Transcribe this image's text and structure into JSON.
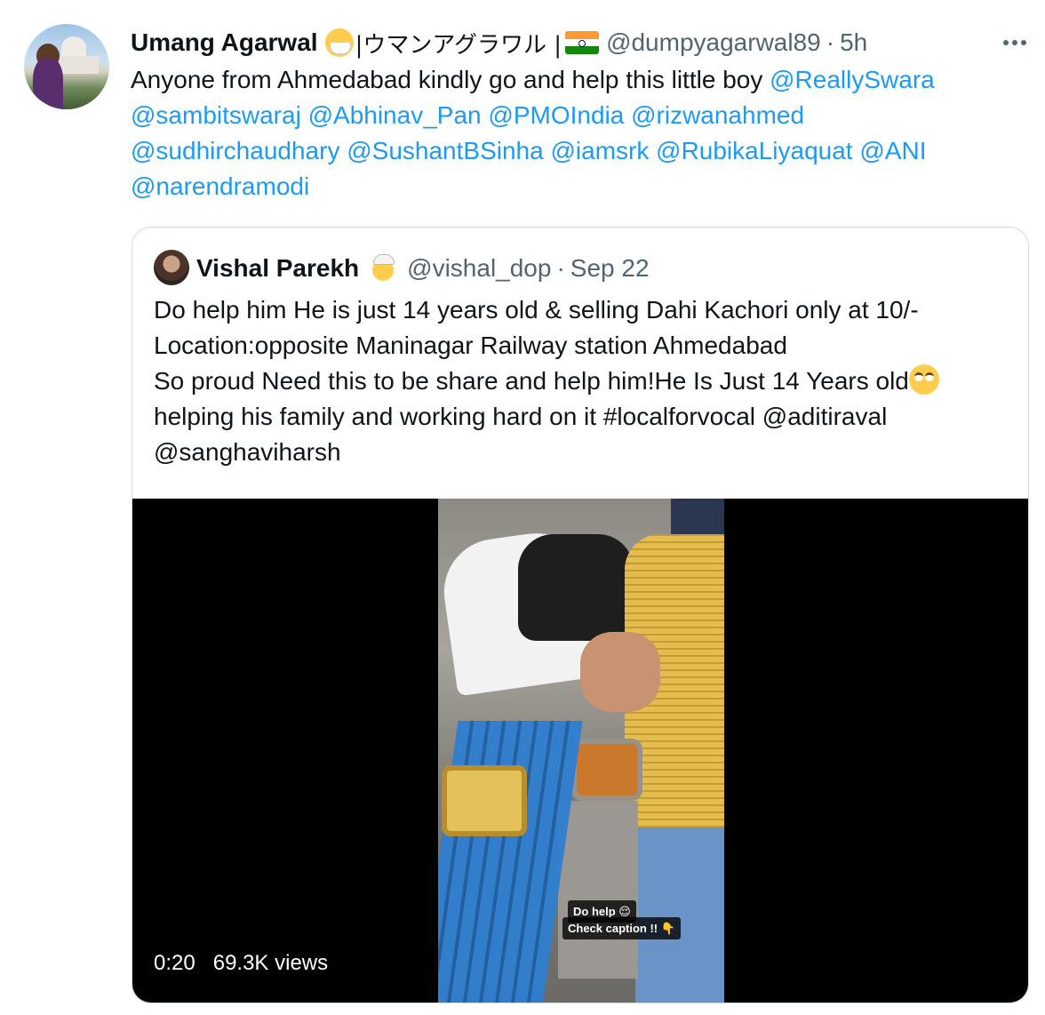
{
  "tweet": {
    "author_name": "Umang Agarwal",
    "author_suffix": "|ウマンアグラワル |",
    "author_handle": "@dumpyagarwal89",
    "dot": "·",
    "time": "5h",
    "text_plain": "Anyone from Ahmedabad kindly go and help this little boy ",
    "mentions": [
      "@ReallySwara",
      "@sambitswaraj",
      "@Abhinav_Pan",
      "@PMOIndia",
      "@rizwanahmed",
      "@sudhirchaudhary",
      "@SushantBSinha",
      "@iamsrk",
      "@RubikaLiyaquat",
      "@ANI",
      "@narendramodi"
    ],
    "icons": {
      "mask": "face-with-medical-mask-icon",
      "flag": "india-flag-icon",
      "more": "more-options-icon"
    }
  },
  "quote": {
    "author_name": "Vishal Parekh",
    "author_handle": "@vishal_dop",
    "dot": "·",
    "date": "Sep 22",
    "lines": [
      "Do help him He is just 14 years old & selling Dahi Kachori only at 10/-",
      "Location:opposite Maninagar Railway station Ahmedabad",
      "So proud Need this to be share and help him!He Is Just 14 Years old",
      "helping his family and working hard on it #localforvocal @aditiraval",
      "@sanghaviharsh"
    ],
    "icons": {
      "badge": "person-with-turban-icon",
      "eyeroll": "face-with-rolling-eyes-icon"
    },
    "video": {
      "duration": "0:20",
      "views": "69.3K views",
      "overlay_line1": "Do help 😌",
      "overlay_line2": "Check caption !! 👇"
    }
  },
  "colors": {
    "link": "#1d9bf0",
    "secondary": "#536471",
    "border": "#cfd9de"
  }
}
